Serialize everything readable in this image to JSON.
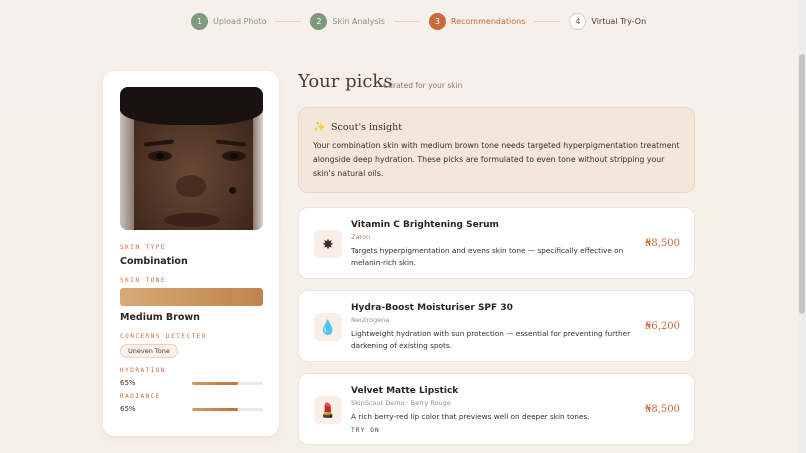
{
  "stepper": {
    "steps": [
      {
        "num": "1",
        "label": "Upload Photo",
        "state": "done"
      },
      {
        "num": "2",
        "label": "Skin Analysis",
        "state": "done"
      },
      {
        "num": "3",
        "label": "Recommendations",
        "state": "active"
      },
      {
        "num": "4",
        "label": "Virtual Try-On",
        "state": "todo"
      }
    ]
  },
  "profile": {
    "skin_type_label": "SKIN TYPE",
    "skin_type": "Combination",
    "skin_tone_label": "SKIN TONE",
    "skin_tone": "Medium Brown",
    "concerns_label": "CONCERNS DETECTED",
    "concerns": [
      "Uneven Tone"
    ],
    "hydration_label": "HYDRATION",
    "hydration_value": "65%",
    "hydration_level": 0.65,
    "radiance_label": "RADIANCE",
    "radiance_value": "65%",
    "radiance_level": 0.65
  },
  "main": {
    "title": "Your picks",
    "subtitle": "Curated for your skin"
  },
  "insight": {
    "icon": "sparkle-icon",
    "title": "Scout's insight",
    "body": "Your combination skin with medium brown tone needs targeted hyperpigmentation treatment alongside deep hydration. These picks are formulated to even tone without stripping your skin's natural oils."
  },
  "products": [
    {
      "icon": "sun-icon",
      "glyph": "✸",
      "name": "Vitamin C Brightening Serum",
      "brand": "Zaron",
      "description": "Targets hyperpigmentation and evens skin tone — specifically effective on melanin-rich skin.",
      "price": "₦8,500"
    },
    {
      "icon": "droplet-icon",
      "glyph": "💧",
      "name": "Hydra-Boost Moisturiser SPF 30",
      "brand": "Neutrogena",
      "description": "Lightweight hydration with sun protection — essential for preventing further darkening of existing spots.",
      "price": "₦6,200"
    },
    {
      "icon": "lipstick-icon",
      "glyph": "💄",
      "name": "Velvet Matte Lipstick",
      "brand": "SkinScout Demo · Berry Rouge",
      "description": "A rich berry-red lip color that previews well on deeper skin tones.",
      "price": "₦8,500",
      "action": "TRY ON"
    }
  ],
  "colors": {
    "accent": "#c96a3a",
    "done": "#7d9a7d",
    "background": "#f7f0ea"
  }
}
